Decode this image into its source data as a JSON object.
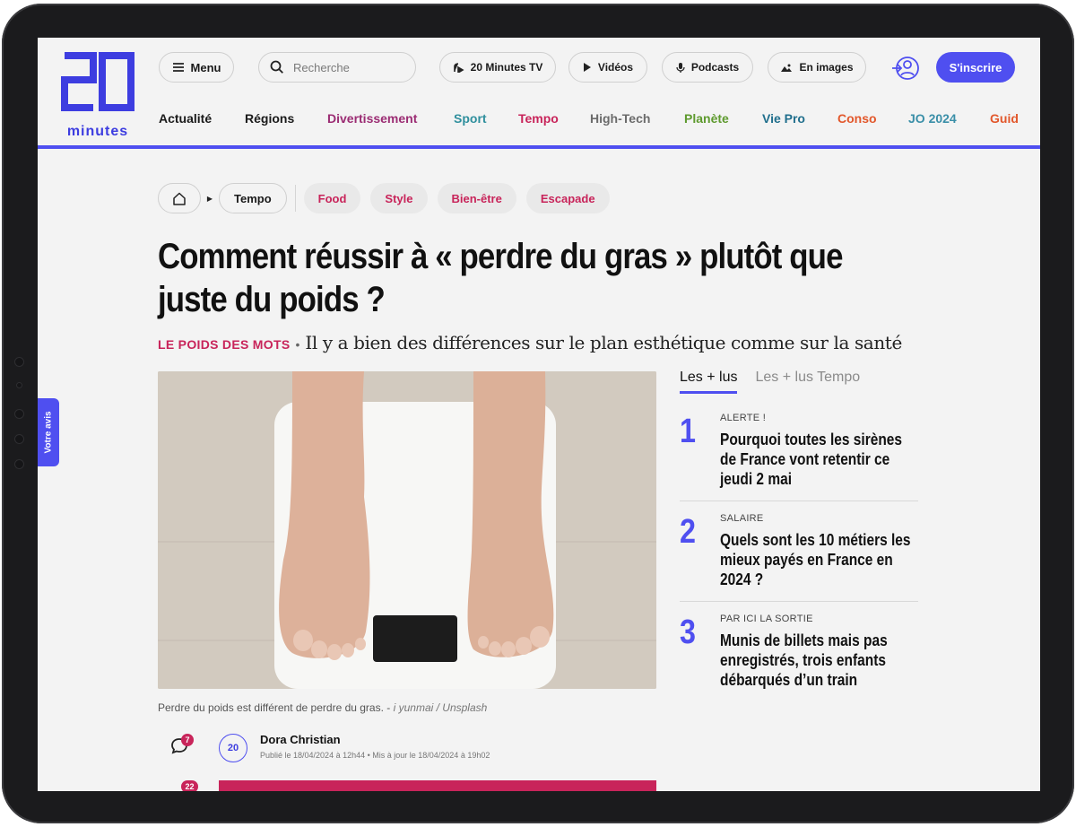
{
  "header": {
    "logo_number": "20",
    "logo_word": "minutes",
    "menu_label": "Menu",
    "search_placeholder": "Recherche",
    "pills": [
      {
        "label": "20 Minutes TV",
        "icon": "tv-icon"
      },
      {
        "label": "Vidéos",
        "icon": "play-icon"
      },
      {
        "label": "Podcasts",
        "icon": "microphone-icon"
      },
      {
        "label": "En images",
        "icon": "image-icon"
      }
    ],
    "signup_label": "S'inscrire",
    "nav": [
      {
        "label": "Actualité",
        "color": "#1a1a1a"
      },
      {
        "label": "Régions",
        "color": "#1a1a1a"
      },
      {
        "label": "Divertissement",
        "color": "#9b2c73"
      },
      {
        "label": "Sport",
        "color": "#2f8f9d"
      },
      {
        "label": "Tempo",
        "color": "#c8245a"
      },
      {
        "label": "High-Tech",
        "color": "#6b6b6b"
      },
      {
        "label": "Planète",
        "color": "#5e9a2e"
      },
      {
        "label": "Vie Pro",
        "color": "#1f6e8c"
      },
      {
        "label": "Conso",
        "color": "#e2572b"
      },
      {
        "label": "JO 2024",
        "color": "#3a8fa8"
      },
      {
        "label": "Guid",
        "color": "#e2572b"
      }
    ]
  },
  "breadcrumb": {
    "current": "Tempo",
    "tags": [
      "Food",
      "Style",
      "Bien-être",
      "Escapade"
    ]
  },
  "article": {
    "headline": "Comment réussir à « perdre du gras » plutôt que juste du poids ?",
    "kicker": "LE POIDS DES MOTS",
    "kicker_sep": "•",
    "standfirst": "Il y a bien des différences sur le plan esthétique comme sur la santé",
    "caption": "Perdre du poids est différent de perdre du gras.",
    "caption_sep": " - ",
    "credit": "i yunmai / Unsplash",
    "comment_count": "7",
    "second_count": "22",
    "author_avatar_text": "20",
    "author": "Dora Christian",
    "meta": "Publié le 18/04/2024 à 12h44 • Mis à jour le 18/04/2024 à 19h02"
  },
  "most_read": {
    "tabs": [
      "Les + lus",
      "Les + lus Tempo"
    ],
    "items": [
      {
        "rank": "1",
        "kicker": "ALERTE !",
        "title": "Pourquoi toutes les sirènes de France vont retentir ce jeudi 2 mai"
      },
      {
        "rank": "2",
        "kicker": "SALAIRE",
        "title": "Quels sont les 10 métiers les mieux payés en France en 2024 ?"
      },
      {
        "rank": "3",
        "kicker": "PAR ICI LA SORTIE",
        "title": "Munis de billets mais pas enregistrés, trois enfants débarqués d’un train"
      }
    ]
  },
  "feedback_label": "Votre avis",
  "colors": {
    "accent": "#4f4ff0",
    "tempo": "#c8245a"
  }
}
